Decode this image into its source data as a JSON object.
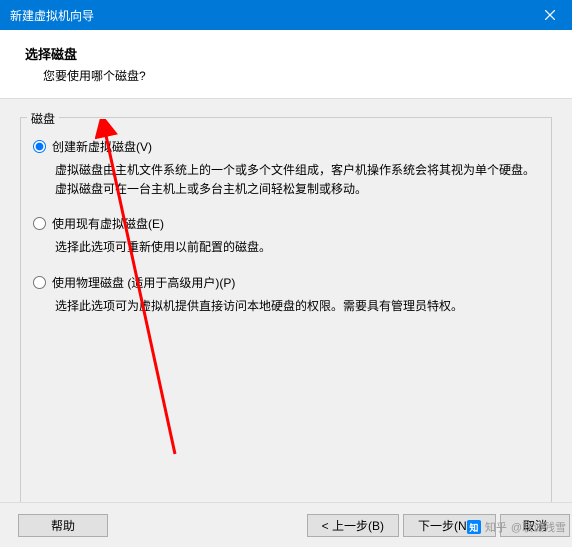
{
  "titlebar": {
    "title": "新建虚拟机向导"
  },
  "header": {
    "title": "选择磁盘",
    "subtitle": "您要使用哪个磁盘?"
  },
  "fieldset": {
    "legend": "磁盘"
  },
  "options": [
    {
      "label": "创建新虚拟磁盘(V)",
      "description": "虚拟磁盘由主机文件系统上的一个或多个文件组成，客户机操作系统会将其视为单个硬盘。虚拟磁盘可在一台主机上或多台主机之间轻松复制或移动。",
      "checked": true
    },
    {
      "label": "使用现有虚拟磁盘(E)",
      "description": "选择此选项可重新使用以前配置的磁盘。",
      "checked": false
    },
    {
      "label": "使用物理磁盘 (适用于高级用户)(P)",
      "description": "选择此选项可为虚拟机提供直接访问本地硬盘的权限。需要具有管理员特权。",
      "checked": false
    }
  ],
  "buttons": {
    "help": "帮助",
    "back": "< 上一步(B)",
    "next": "下一步(N) >",
    "cancel": "取消"
  },
  "watermark": {
    "text": "@联诚残雪",
    "logo": "知乎"
  }
}
